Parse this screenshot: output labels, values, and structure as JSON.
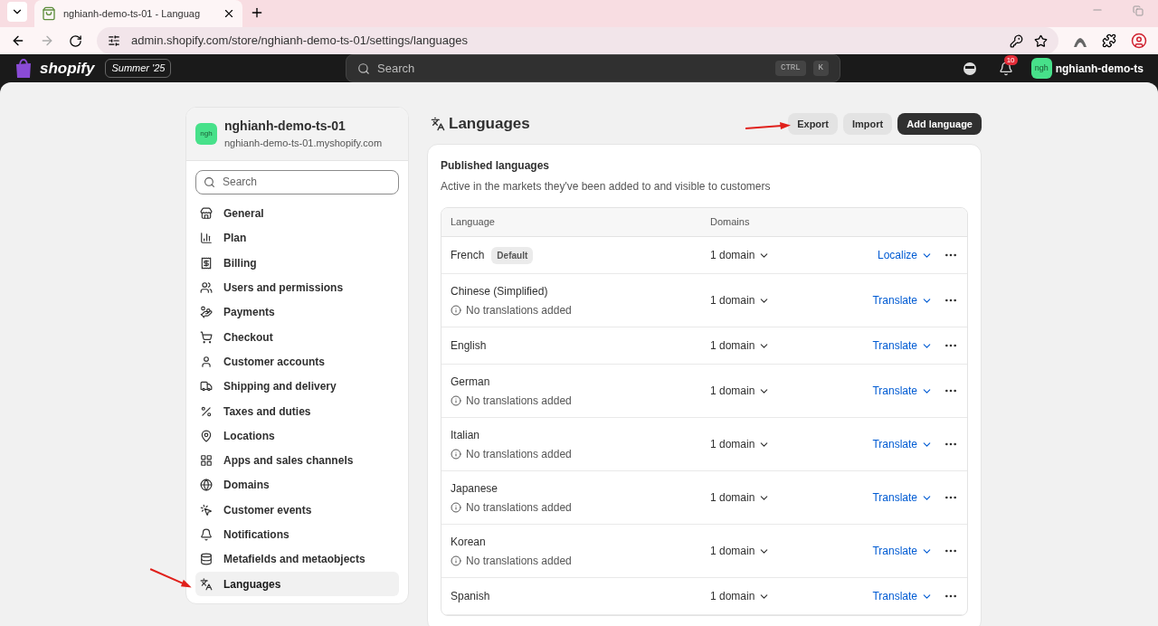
{
  "browser": {
    "tab_title": "nghianh-demo-ts-01 - Languag",
    "url": "admin.shopify.com/store/nghianh-demo-ts-01/settings/languages"
  },
  "topbar": {
    "brand": "shopify",
    "edition": "Summer '25",
    "search_placeholder": "Search",
    "shortcut": [
      "CTRL",
      "K"
    ],
    "notification_count": "10",
    "avatar": "ngh",
    "store": "nghianh-demo-ts"
  },
  "sidebar": {
    "avatar": "ngh",
    "store_name": "nghianh-demo-ts-01",
    "store_domain": "nghianh-demo-ts-01.myshopify.com",
    "search_placeholder": "Search",
    "items": [
      {
        "label": "General",
        "selected": false
      },
      {
        "label": "Plan",
        "selected": false
      },
      {
        "label": "Billing",
        "selected": false
      },
      {
        "label": "Users and permissions",
        "selected": false
      },
      {
        "label": "Payments",
        "selected": false
      },
      {
        "label": "Checkout",
        "selected": false
      },
      {
        "label": "Customer accounts",
        "selected": false
      },
      {
        "label": "Shipping and delivery",
        "selected": false
      },
      {
        "label": "Taxes and duties",
        "selected": false
      },
      {
        "label": "Locations",
        "selected": false
      },
      {
        "label": "Apps and sales channels",
        "selected": false
      },
      {
        "label": "Domains",
        "selected": false
      },
      {
        "label": "Customer events",
        "selected": false
      },
      {
        "label": "Notifications",
        "selected": false
      },
      {
        "label": "Metafields and metaobjects",
        "selected": false
      },
      {
        "label": "Languages",
        "selected": true
      }
    ]
  },
  "page": {
    "title": "Languages",
    "buttons": [
      {
        "label": "Export",
        "kind": "secondary"
      },
      {
        "label": "Import",
        "kind": "secondary"
      },
      {
        "label": "Add language",
        "kind": "primary"
      }
    ],
    "card": {
      "title": "Published languages",
      "subtitle": "Active in the markets they've been added to and visible to customers",
      "columns": [
        "Language",
        "Domains"
      ],
      "rows": [
        {
          "language": "French",
          "badge": "Default",
          "domains": "1 domain",
          "action": "Localize"
        },
        {
          "language": "Chinese (Simplified)",
          "note": "No translations added",
          "domains": "1 domain",
          "action": "Translate"
        },
        {
          "language": "English",
          "domains": "1 domain",
          "action": "Translate"
        },
        {
          "language": "German",
          "note": "No translations added",
          "domains": "1 domain",
          "action": "Translate"
        },
        {
          "language": "Italian",
          "note": "No translations added",
          "domains": "1 domain",
          "action": "Translate"
        },
        {
          "language": "Japanese",
          "note": "No translations added",
          "domains": "1 domain",
          "action": "Translate"
        },
        {
          "language": "Korean",
          "note": "No translations added",
          "domains": "1 domain",
          "action": "Translate"
        },
        {
          "language": "Spanish",
          "domains": "1 domain",
          "action": "Translate"
        }
      ]
    }
  }
}
